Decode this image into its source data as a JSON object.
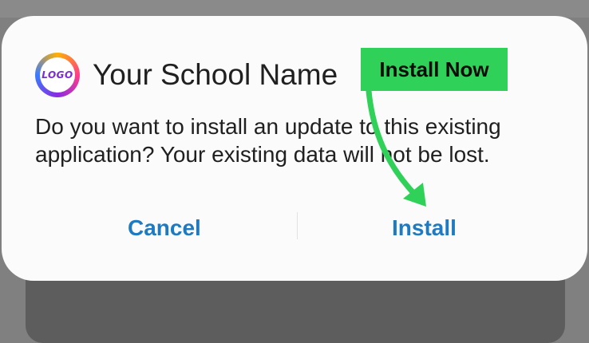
{
  "dialog": {
    "app_name": "Your School Name",
    "logo_text": "LOGO",
    "message": "Do you want to install an update to this existing application? Your existing data will not be lost.",
    "cancel_label": "Cancel",
    "install_label": "Install"
  },
  "annotation": {
    "callout_text": "Install Now",
    "callout_color": "#2fd158"
  },
  "colors": {
    "button_text": "#1f7ac0",
    "dialog_bg": "#fbfbfb",
    "scrim": "#808080"
  },
  "icons": {
    "logo": "app-logo-icon",
    "arrow": "curved-arrow-icon"
  }
}
